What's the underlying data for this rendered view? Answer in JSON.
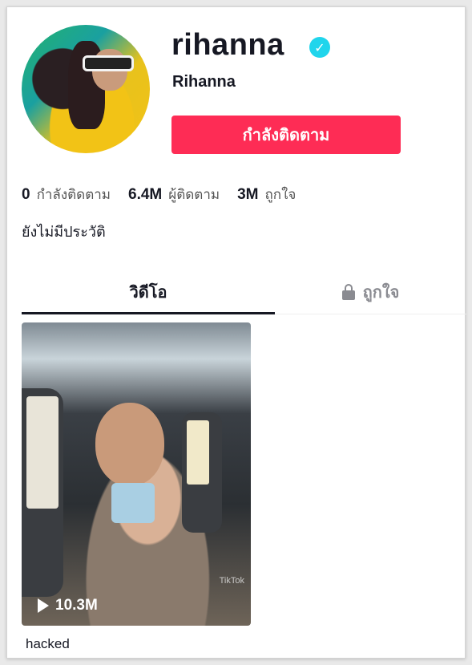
{
  "profile": {
    "username": "rihanna",
    "display_name": "Rihanna",
    "verified_mark": "✓",
    "follow_button_label": "กำลังติดตาม",
    "bio": "ยังไม่มีประวัติ"
  },
  "stats": [
    {
      "value": "0",
      "label": "กำลังติดตาม"
    },
    {
      "value": "6.4M",
      "label": "ผู้ติดตาม"
    },
    {
      "value": "3M",
      "label": "ถูกใจ"
    }
  ],
  "tabs": {
    "videos": "วิดีโอ",
    "liked": "ถูกใจ"
  },
  "videos": [
    {
      "play_count": "10.3M",
      "watermark": "TikTok",
      "caption": "hacked"
    }
  ],
  "colors": {
    "accent": "#fe2c55",
    "verified": "#20d5ec",
    "text": "#161823",
    "muted": "#8a8b91"
  },
  "icons": {
    "verified": "verified-check-icon",
    "lock": "lock-icon",
    "play": "play-icon"
  }
}
